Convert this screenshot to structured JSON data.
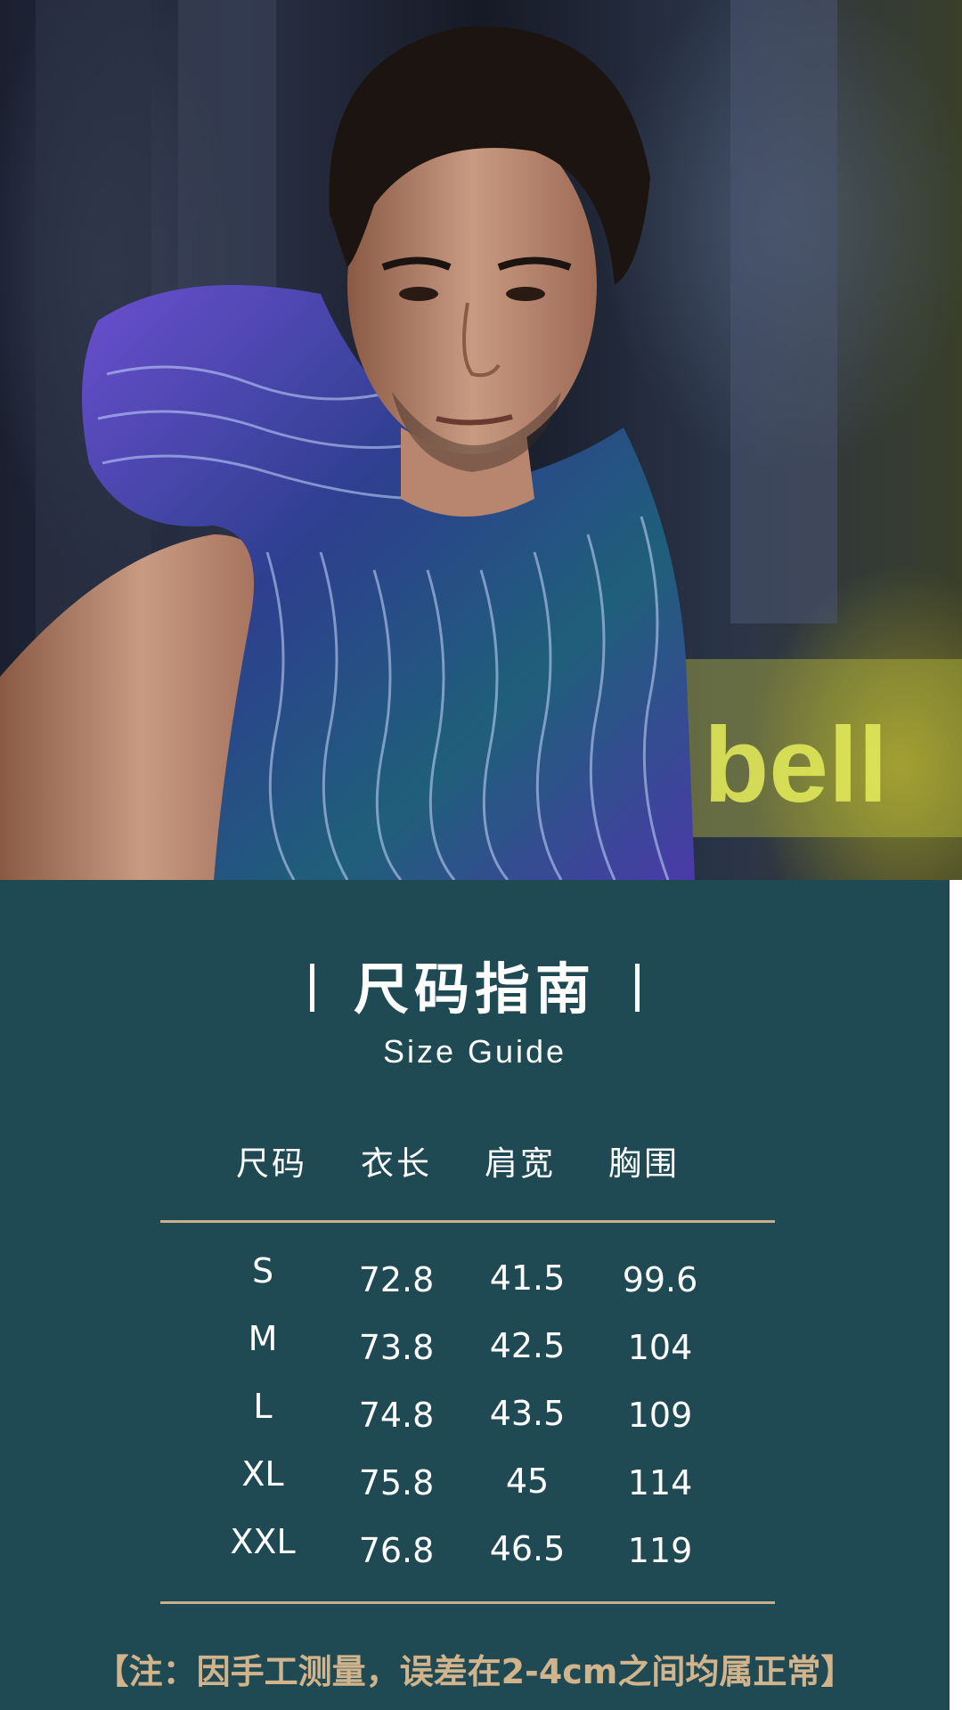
{
  "photo": {
    "description_icon": "model-photo-icon"
  },
  "guide": {
    "title": "尺码指南",
    "subtitle": "Size Guide",
    "headers": [
      "尺码",
      "衣长",
      "肩宽",
      "胸围"
    ],
    "rows": [
      [
        "S",
        "72.8",
        "41.5",
        "99.6"
      ],
      [
        "M",
        "73.8",
        "42.5",
        "104"
      ],
      [
        "L",
        "74.8",
        "43.5",
        "109"
      ],
      [
        "XL",
        "75.8",
        "45",
        "114"
      ],
      [
        "XXL",
        "76.8",
        "46.5",
        "119"
      ]
    ],
    "note": "【注：因手工测量，误差在2-4cm之间均属正常】"
  },
  "colors": {
    "panel_bg": "#1f4a54",
    "rule": "#c8b08a",
    "note_text": "#d2b48c"
  }
}
